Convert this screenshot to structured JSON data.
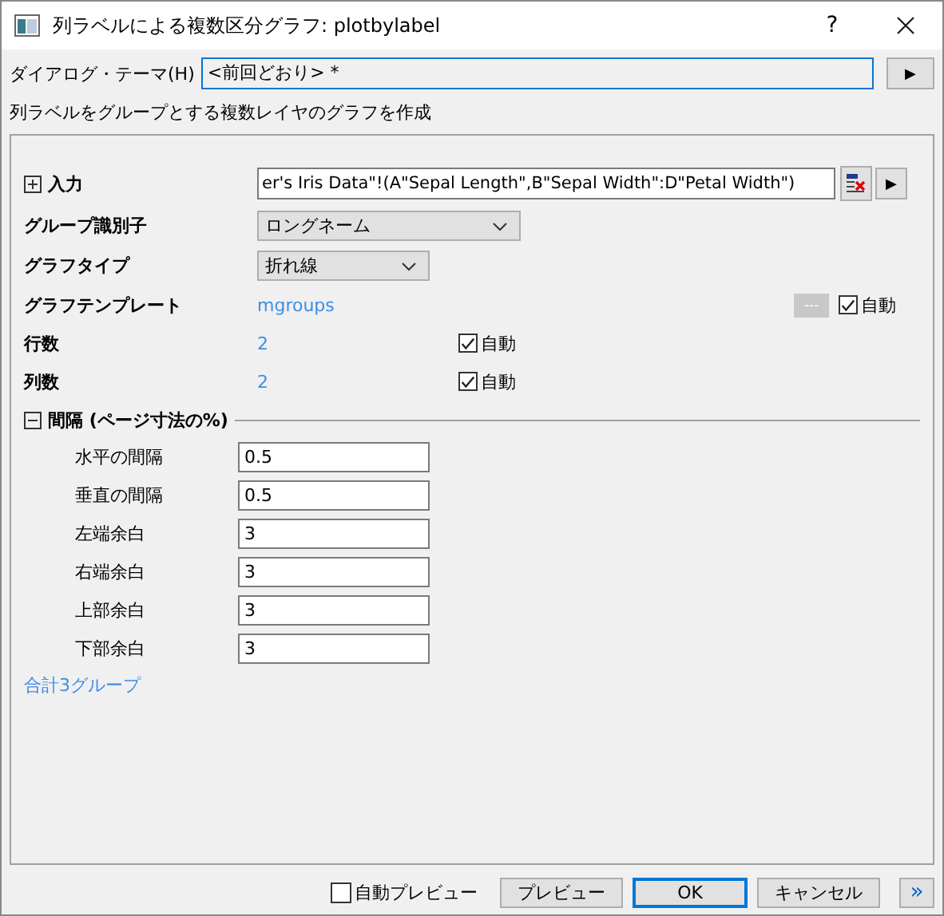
{
  "window": {
    "title": "列ラベルによる複数区分グラフ: plotbylabel",
    "help": "?"
  },
  "theme": {
    "label": "ダイアログ・テーマ(H)",
    "value": "<前回どおり> *",
    "button": "▶"
  },
  "description": "列ラベルをグループとする複数レイヤのグラフを作成",
  "input": {
    "label": "入力",
    "expanded": false,
    "value": "er's Iris Data\"!(A\"Sepal Length\",B\"Sepal Width\":D\"Petal Width\")",
    "button": "▶"
  },
  "group_id": {
    "label": "グループ識別子",
    "value": "ロングネーム"
  },
  "graph_type": {
    "label": "グラフタイプ",
    "value": "折れ線"
  },
  "template": {
    "label": "グラフテンプレート",
    "value": "mgroups",
    "browse": "---",
    "auto": {
      "label": "自動",
      "checked": true
    }
  },
  "rows": {
    "label": "行数",
    "value": "2",
    "auto": {
      "label": "自動",
      "checked": true
    }
  },
  "cols": {
    "label": "列数",
    "value": "2",
    "auto": {
      "label": "自動",
      "checked": true
    }
  },
  "spacing": {
    "label": "間隔 (ページ寸法の%)",
    "expanded": true,
    "fields": [
      {
        "label": "水平の間隔",
        "value": "0.5"
      },
      {
        "label": "垂直の間隔",
        "value": "0.5"
      },
      {
        "label": "左端余白",
        "value": "3"
      },
      {
        "label": "右端余白",
        "value": "3"
      },
      {
        "label": "上部余白",
        "value": "3"
      },
      {
        "label": "下部余白",
        "value": "3"
      }
    ]
  },
  "summary": "合計3グループ",
  "footer": {
    "auto_preview": {
      "label": "自動プレビュー",
      "checked": false
    },
    "preview": "プレビュー",
    "ok": "OK",
    "cancel": "キャンセル",
    "more": "»"
  }
}
